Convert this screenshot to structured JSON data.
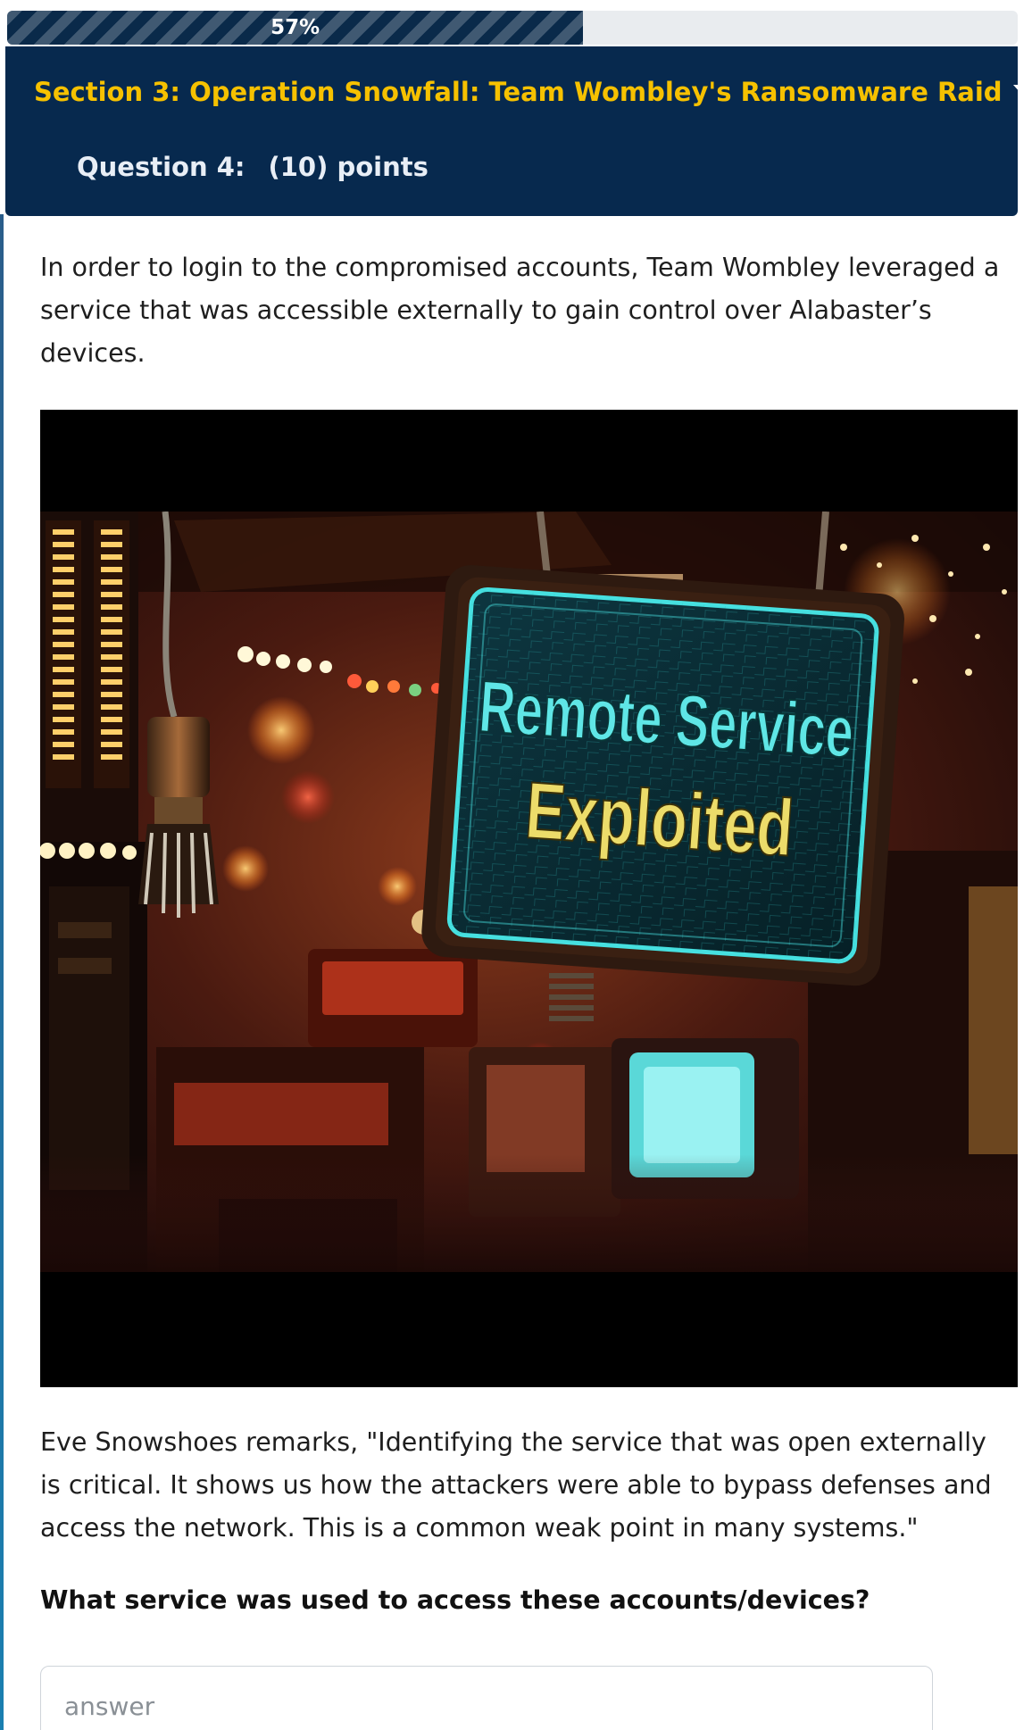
{
  "progress": {
    "percent": 57,
    "label": "57%"
  },
  "header": {
    "section_title": "Section 3: Operation Snowfall: Team Wombley's Ransomware Raid",
    "question_label": "Question 4:",
    "points_label": "(10) points"
  },
  "content": {
    "intro_paragraph": "In order to login to the compromised accounts, Team Wombley leveraged a service that was accessible externally to gain control over Alabaster’s devices.",
    "image": {
      "sign_line_1": "Remote Service",
      "sign_line_2": "Exploited"
    },
    "quote_paragraph": "Eve Snowshoes remarks, \"Identifying the service that was open externally is critical. It shows us how the attackers were able to bypass defenses and access the network. This is a common weak point in many systems.\"",
    "question": "What service was used to access these accounts/devices?"
  },
  "answer": {
    "placeholder": "answer",
    "value": ""
  },
  "colors": {
    "header_bg": "#07294e",
    "section_title": "#f6c100",
    "progress_fill": "#0a2a4a",
    "sign_text_cyan": "#5fe6e6",
    "sign_text_yellow": "#ecdc6a"
  },
  "icons": {
    "section_dropdown": "caret-down-icon"
  }
}
